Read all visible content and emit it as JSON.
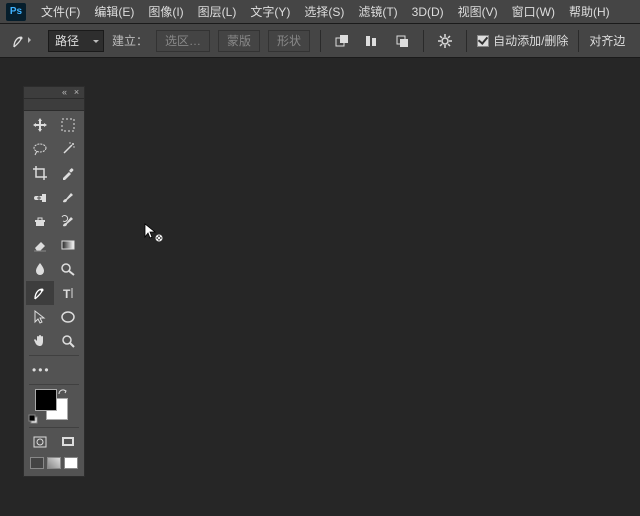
{
  "app": {
    "logo": "Ps"
  },
  "menu": [
    "文件(F)",
    "编辑(E)",
    "图像(I)",
    "图层(L)",
    "文字(Y)",
    "选择(S)",
    "滤镜(T)",
    "3D(D)",
    "视图(V)",
    "窗口(W)",
    "帮助(H)"
  ],
  "optbar": {
    "mode": "路径",
    "build": "建立：",
    "btn1": "选区…",
    "btn2": "蒙版",
    "btn3": "形状",
    "auto": "自动添加/删除",
    "align": "对齐边"
  },
  "tools": {
    "panel_label": ""
  },
  "colors": {
    "fg": "#000000",
    "bg": "#ffffff"
  }
}
